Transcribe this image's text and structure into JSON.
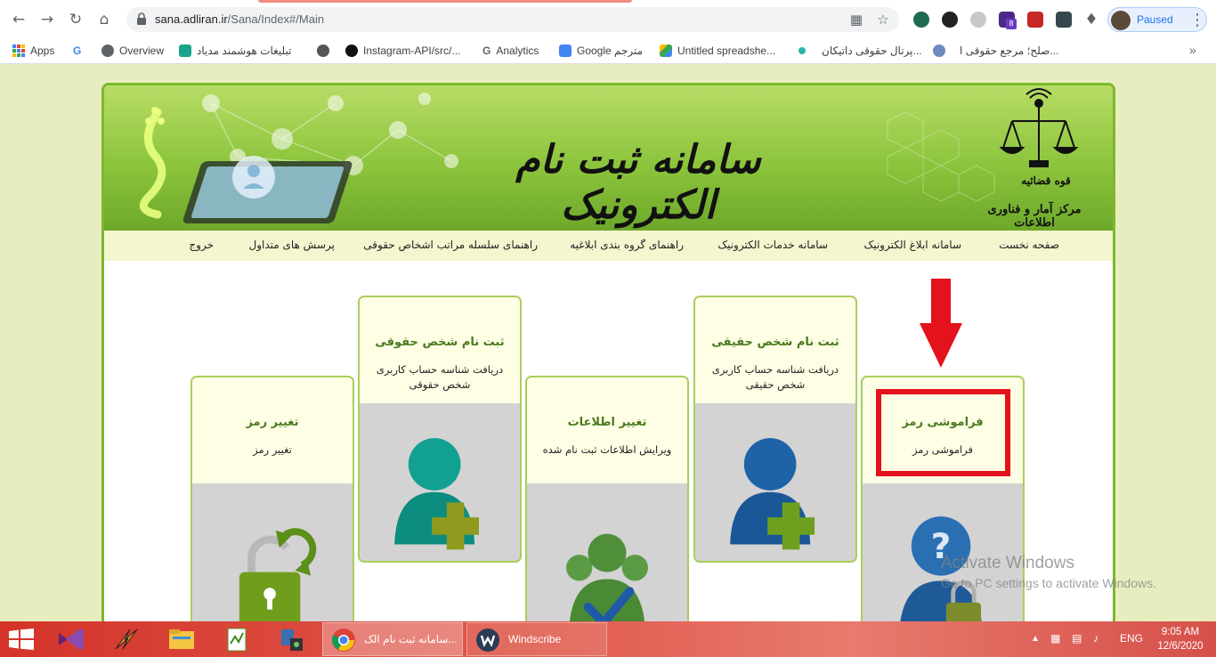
{
  "browser": {
    "url_host": "sana.adliran.ir",
    "url_path": "/Sana/Index#/Main",
    "profile_label": "Paused",
    "extension_badge": "8",
    "bookmarks": [
      {
        "label": "Apps"
      },
      {
        "label": "Overview"
      },
      {
        "label": "تبلیغات هوشمند مدیاد"
      },
      {
        "label": "Instagram-API/src/..."
      },
      {
        "label": "Analytics"
      },
      {
        "label": "Google مترجم"
      },
      {
        "label": "Untitled spreadshe..."
      },
      {
        "label": "پرتال حقوقی داتیکان..."
      },
      {
        "label": "صلح؛ مرجع حقوقی ا..."
      }
    ]
  },
  "banner": {
    "title": "سامانه ثبت نام الکترونیک",
    "seal_line1": "قوه قضائیه",
    "seal_line2": "مرکز آمار و فناوری اطلاعات",
    "monogram": "ثنا"
  },
  "nav": {
    "items": [
      {
        "label": "صفحه نخست"
      },
      {
        "label": "سامانه ابلاغ الکترونیک"
      },
      {
        "label": "سامانه خدمات الکترونیک"
      },
      {
        "label": "راهنمای گروه بندی ابلاغیه"
      },
      {
        "label": "راهنمای سلسله مراتب اشخاص حقوقی"
      },
      {
        "label": "پرسش های متداول"
      },
      {
        "label": "خروج"
      }
    ]
  },
  "cards": [
    {
      "title": "فراموشی رمز",
      "description": "فراموشی رمز",
      "icon": "question-lock-user-icon"
    },
    {
      "title": "ثبت نام شخص حقیقی",
      "description": "دریافت شناسه حساب کاربری شخص حقیقی",
      "icon": "add-user-blue-icon"
    },
    {
      "title": "تغییر اطلاعات",
      "description": "ویرایش اطلاعات ثبت نام شده",
      "icon": "users-check-icon"
    },
    {
      "title": "ثبت نام شخص حقوقی",
      "description": "دریافت شناسه حساب کاربری شخص حقوقی",
      "icon": "add-user-teal-icon"
    },
    {
      "title": "تغییر رمز",
      "description": "تغییر رمز",
      "icon": "refresh-lock-icon"
    }
  ],
  "overlay": {
    "highlight_color": "#e3121b",
    "arrow_color": "#e3121b"
  },
  "watermark": {
    "line1": "Activate Windows",
    "line2": "Go to PC settings to activate Windows."
  },
  "taskbar": {
    "tasks": [
      {
        "label": "سامانه ثبت نام الک..."
      },
      {
        "label": "Windscribe"
      }
    ],
    "language": "ENG",
    "time": "9:05 AM",
    "date": "12/6/2020"
  },
  "colors": {
    "page_bg": "#e8edc0",
    "frame_border": "#7cb82a",
    "card_title": "#4a7a1d",
    "taskbar": "#d4342a"
  }
}
